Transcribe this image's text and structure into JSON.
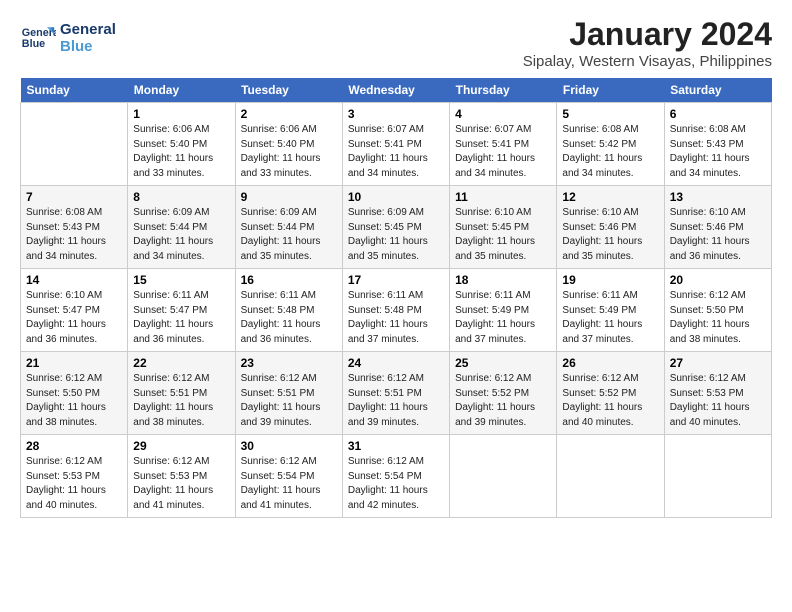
{
  "logo": {
    "line1": "General",
    "line2": "Blue"
  },
  "title": "January 2024",
  "subtitle": "Sipalay, Western Visayas, Philippines",
  "days_of_week": [
    "Sunday",
    "Monday",
    "Tuesday",
    "Wednesday",
    "Thursday",
    "Friday",
    "Saturday"
  ],
  "weeks": [
    [
      {
        "num": "",
        "info": ""
      },
      {
        "num": "1",
        "info": "Sunrise: 6:06 AM\nSunset: 5:40 PM\nDaylight: 11 hours\nand 33 minutes."
      },
      {
        "num": "2",
        "info": "Sunrise: 6:06 AM\nSunset: 5:40 PM\nDaylight: 11 hours\nand 33 minutes."
      },
      {
        "num": "3",
        "info": "Sunrise: 6:07 AM\nSunset: 5:41 PM\nDaylight: 11 hours\nand 34 minutes."
      },
      {
        "num": "4",
        "info": "Sunrise: 6:07 AM\nSunset: 5:41 PM\nDaylight: 11 hours\nand 34 minutes."
      },
      {
        "num": "5",
        "info": "Sunrise: 6:08 AM\nSunset: 5:42 PM\nDaylight: 11 hours\nand 34 minutes."
      },
      {
        "num": "6",
        "info": "Sunrise: 6:08 AM\nSunset: 5:43 PM\nDaylight: 11 hours\nand 34 minutes."
      }
    ],
    [
      {
        "num": "7",
        "info": "Sunrise: 6:08 AM\nSunset: 5:43 PM\nDaylight: 11 hours\nand 34 minutes."
      },
      {
        "num": "8",
        "info": "Sunrise: 6:09 AM\nSunset: 5:44 PM\nDaylight: 11 hours\nand 34 minutes."
      },
      {
        "num": "9",
        "info": "Sunrise: 6:09 AM\nSunset: 5:44 PM\nDaylight: 11 hours\nand 35 minutes."
      },
      {
        "num": "10",
        "info": "Sunrise: 6:09 AM\nSunset: 5:45 PM\nDaylight: 11 hours\nand 35 minutes."
      },
      {
        "num": "11",
        "info": "Sunrise: 6:10 AM\nSunset: 5:45 PM\nDaylight: 11 hours\nand 35 minutes."
      },
      {
        "num": "12",
        "info": "Sunrise: 6:10 AM\nSunset: 5:46 PM\nDaylight: 11 hours\nand 35 minutes."
      },
      {
        "num": "13",
        "info": "Sunrise: 6:10 AM\nSunset: 5:46 PM\nDaylight: 11 hours\nand 36 minutes."
      }
    ],
    [
      {
        "num": "14",
        "info": "Sunrise: 6:10 AM\nSunset: 5:47 PM\nDaylight: 11 hours\nand 36 minutes."
      },
      {
        "num": "15",
        "info": "Sunrise: 6:11 AM\nSunset: 5:47 PM\nDaylight: 11 hours\nand 36 minutes."
      },
      {
        "num": "16",
        "info": "Sunrise: 6:11 AM\nSunset: 5:48 PM\nDaylight: 11 hours\nand 36 minutes."
      },
      {
        "num": "17",
        "info": "Sunrise: 6:11 AM\nSunset: 5:48 PM\nDaylight: 11 hours\nand 37 minutes."
      },
      {
        "num": "18",
        "info": "Sunrise: 6:11 AM\nSunset: 5:49 PM\nDaylight: 11 hours\nand 37 minutes."
      },
      {
        "num": "19",
        "info": "Sunrise: 6:11 AM\nSunset: 5:49 PM\nDaylight: 11 hours\nand 37 minutes."
      },
      {
        "num": "20",
        "info": "Sunrise: 6:12 AM\nSunset: 5:50 PM\nDaylight: 11 hours\nand 38 minutes."
      }
    ],
    [
      {
        "num": "21",
        "info": "Sunrise: 6:12 AM\nSunset: 5:50 PM\nDaylight: 11 hours\nand 38 minutes."
      },
      {
        "num": "22",
        "info": "Sunrise: 6:12 AM\nSunset: 5:51 PM\nDaylight: 11 hours\nand 38 minutes."
      },
      {
        "num": "23",
        "info": "Sunrise: 6:12 AM\nSunset: 5:51 PM\nDaylight: 11 hours\nand 39 minutes."
      },
      {
        "num": "24",
        "info": "Sunrise: 6:12 AM\nSunset: 5:51 PM\nDaylight: 11 hours\nand 39 minutes."
      },
      {
        "num": "25",
        "info": "Sunrise: 6:12 AM\nSunset: 5:52 PM\nDaylight: 11 hours\nand 39 minutes."
      },
      {
        "num": "26",
        "info": "Sunrise: 6:12 AM\nSunset: 5:52 PM\nDaylight: 11 hours\nand 40 minutes."
      },
      {
        "num": "27",
        "info": "Sunrise: 6:12 AM\nSunset: 5:53 PM\nDaylight: 11 hours\nand 40 minutes."
      }
    ],
    [
      {
        "num": "28",
        "info": "Sunrise: 6:12 AM\nSunset: 5:53 PM\nDaylight: 11 hours\nand 40 minutes."
      },
      {
        "num": "29",
        "info": "Sunrise: 6:12 AM\nSunset: 5:53 PM\nDaylight: 11 hours\nand 41 minutes."
      },
      {
        "num": "30",
        "info": "Sunrise: 6:12 AM\nSunset: 5:54 PM\nDaylight: 11 hours\nand 41 minutes."
      },
      {
        "num": "31",
        "info": "Sunrise: 6:12 AM\nSunset: 5:54 PM\nDaylight: 11 hours\nand 42 minutes."
      },
      {
        "num": "",
        "info": ""
      },
      {
        "num": "",
        "info": ""
      },
      {
        "num": "",
        "info": ""
      }
    ]
  ]
}
